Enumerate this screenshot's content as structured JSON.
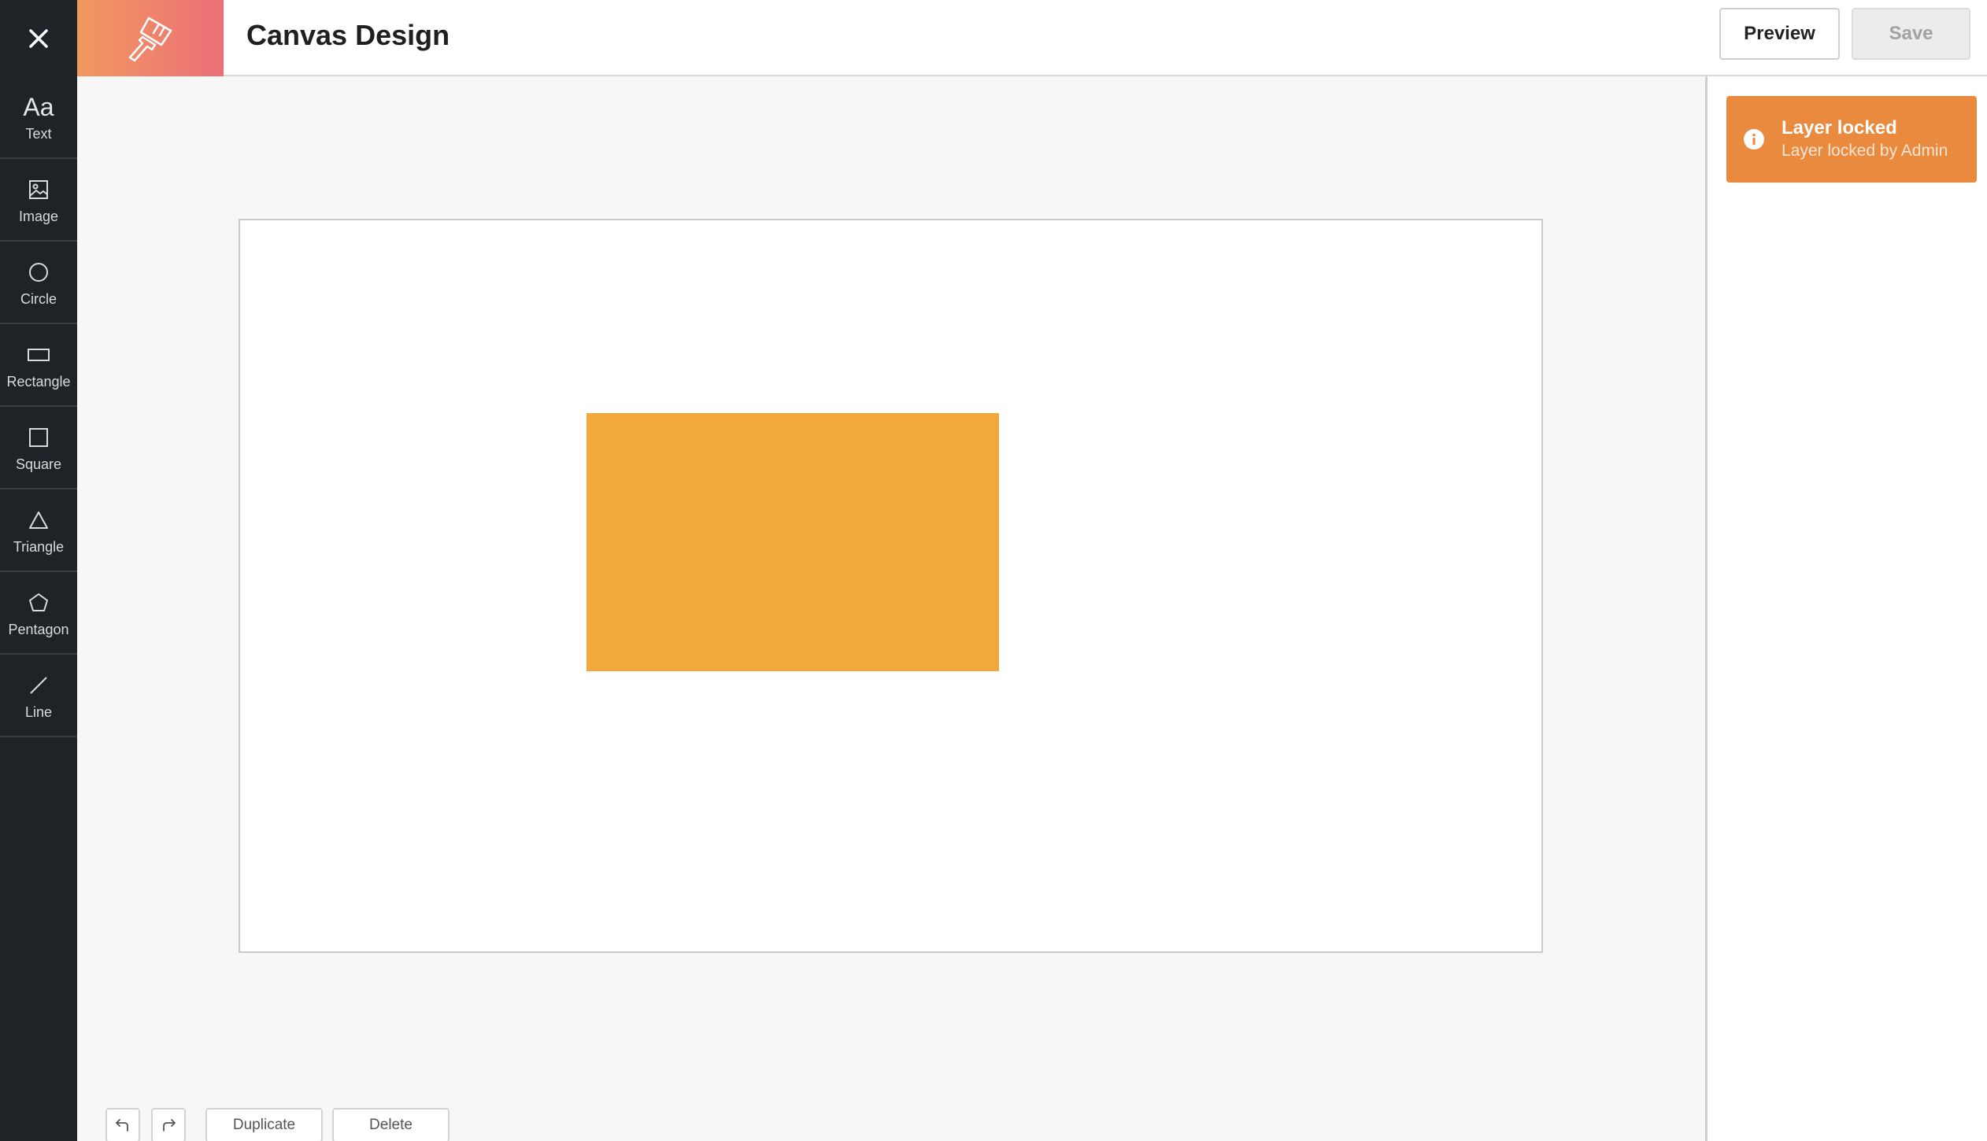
{
  "header": {
    "title": "Canvas Design",
    "preview_label": "Preview",
    "save_label": "Save"
  },
  "toolbar": {
    "items": [
      {
        "label": "Text",
        "icon": "text-aa-icon"
      },
      {
        "label": "Image",
        "icon": "image-icon"
      },
      {
        "label": "Circle",
        "icon": "circle-icon"
      },
      {
        "label": "Rectangle",
        "icon": "rectangle-icon"
      },
      {
        "label": "Square",
        "icon": "square-icon"
      },
      {
        "label": "Triangle",
        "icon": "triangle-icon"
      },
      {
        "label": "Pentagon",
        "icon": "pentagon-icon"
      },
      {
        "label": "Line",
        "icon": "line-icon"
      }
    ],
    "text_glyph": "Aa"
  },
  "canvas": {
    "shapes": [
      {
        "type": "rectangle",
        "color": "#f2a83b"
      }
    ]
  },
  "actions": {
    "undo_icon": "undo-icon",
    "redo_icon": "redo-icon",
    "duplicate_label": "Duplicate",
    "delete_label": "Delete"
  },
  "notification": {
    "title": "Layer locked",
    "message": "Layer locked by Admin",
    "icon": "info-icon",
    "color": "#ea8a3f"
  },
  "colors": {
    "sidebar": "#1f2226",
    "accent_gradient_start": "#f1995f",
    "accent_gradient_end": "#ec6f79"
  }
}
